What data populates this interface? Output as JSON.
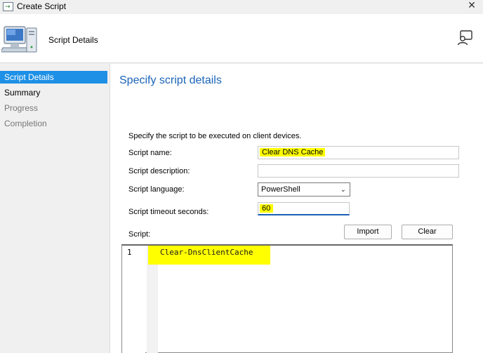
{
  "window": {
    "title": "Create Script"
  },
  "header": {
    "page_heading": "Script Details"
  },
  "nav": {
    "items": [
      {
        "label": "Script Details",
        "state": "active"
      },
      {
        "label": "Summary",
        "state": "normal"
      },
      {
        "label": "Progress",
        "state": "disabled"
      },
      {
        "label": "Completion",
        "state": "disabled"
      }
    ]
  },
  "main": {
    "section_title": "Specify script details",
    "instructions": "Specify the script to be executed on client devices.",
    "script_name": {
      "label": "Script name:",
      "value": "Clear DNS Cache"
    },
    "script_description": {
      "label": "Script description:",
      "value": ""
    },
    "script_language": {
      "label": "Script language:",
      "value": "PowerShell"
    },
    "script_timeout": {
      "label": "Script timeout seconds:",
      "value": "60"
    },
    "script": {
      "label": "Script:",
      "import_label": "Import",
      "clear_label": "Clear"
    },
    "editor": {
      "line_number": "1",
      "code": "Clear-DnsClientCache"
    }
  },
  "colors": {
    "accent": "#1e90e6",
    "heading": "#1a64b8",
    "highlight": "#ffff00"
  },
  "icons": [
    "script-window-icon",
    "close-icon",
    "computer-icon",
    "feedback-icon",
    "chevron-down-icon"
  ]
}
